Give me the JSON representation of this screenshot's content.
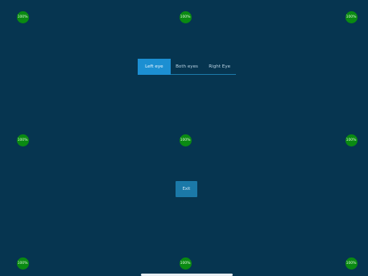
{
  "markers": {
    "top_left": "100%",
    "top_center": "100%",
    "top_right": "100%",
    "middle_left": "100%",
    "middle_center": "100%",
    "middle_right": "100%",
    "bottom_left": "100%",
    "bottom_center": "100%",
    "bottom_right": "100%"
  },
  "eye_tabs": {
    "left_eye": "Left eye",
    "both_eyes": "Both eyes",
    "right_eye": "Right Eye",
    "selected": "Left eye"
  },
  "exit_label": "Exit",
  "colors": {
    "background": "#063550",
    "marker": "#0a8a12",
    "active_tab": "#1c8fd2",
    "button": "#1b79a8"
  }
}
